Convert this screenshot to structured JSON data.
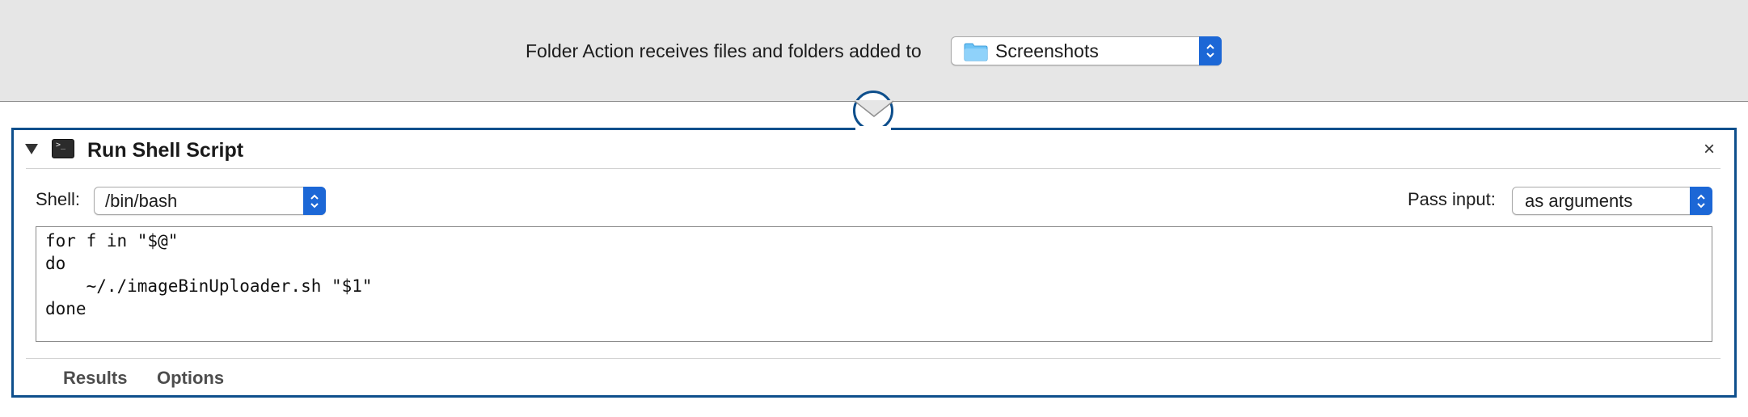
{
  "header": {
    "receives_label": "Folder Action receives files and folders added to",
    "folder_popup": {
      "value": "Screenshots",
      "icon": "folder-icon"
    }
  },
  "action": {
    "title": "Run Shell Script",
    "icon": "terminal-icon",
    "disclosure_icon": "disclosure-triangle-down-icon",
    "close_label": "×",
    "shell": {
      "label": "Shell:",
      "value": "/bin/bash"
    },
    "pass_input": {
      "label": "Pass input:",
      "value": "as arguments"
    },
    "script_lines": [
      "for f in \"$@\"",
      "do",
      "    ~/./imageBinUploader.sh \"$1\"",
      "done"
    ],
    "tabs": [
      "Results",
      "Options"
    ]
  },
  "colors": {
    "accent_blue": "#1c67d6",
    "card_border": "#0e4f8c",
    "header_bg": "#e6e6e6",
    "folder_blue": "#6ec3f5"
  }
}
